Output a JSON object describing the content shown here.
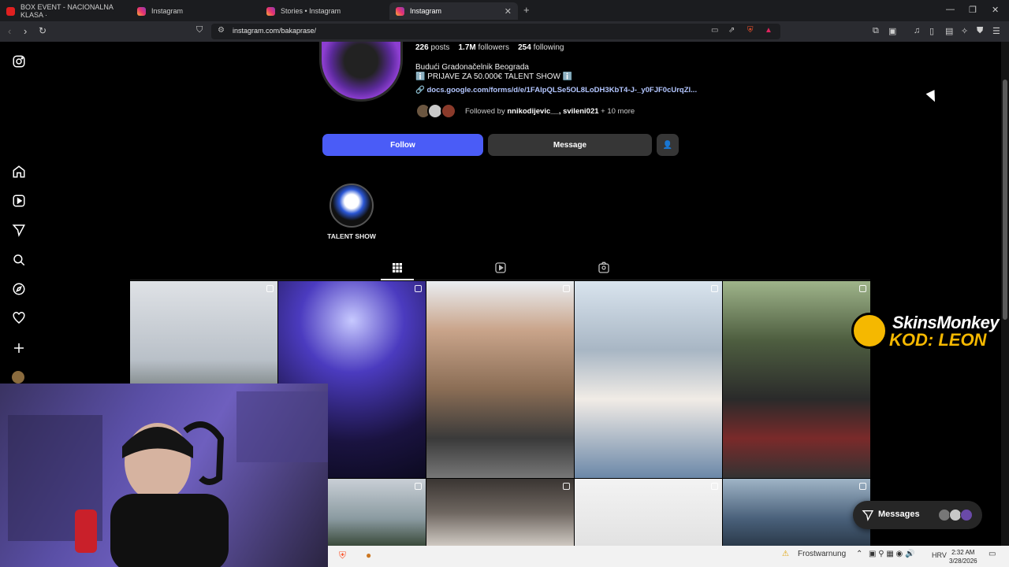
{
  "browser": {
    "tabs": [
      {
        "title": "BOX EVENT - NACIONALNA KLASA ·",
        "favicon": "youtube-icon",
        "active": false
      },
      {
        "title": "Instagram",
        "favicon": "instagram-icon",
        "active": false
      },
      {
        "title": "Stories • Instagram",
        "favicon": "instagram-icon",
        "active": false
      },
      {
        "title": "Instagram",
        "favicon": "instagram-icon",
        "active": true
      }
    ],
    "url": "instagram.com/bakaprase/"
  },
  "profile": {
    "stats": {
      "posts_value": "226",
      "posts_label": "posts",
      "followers_value": "1.7M",
      "followers_label": "followers",
      "following_value": "254",
      "following_label": "following"
    },
    "bio_line1": "Budući Gradonačelnik Beograda",
    "bio_line2": "ℹ️ PRIJAVE ZA 50.000€ TALENT SHOW ℹ️",
    "link": "docs.google.com/forms/d/e/1FAIpQLSe5OL8LoDH3KbT4-J-_y0FJF0cUrqZl...",
    "followed_by_prefix": "Followed by",
    "followed_by_names": "nnikodijevic__, svileni021",
    "followed_by_suffix": "+ 10 more",
    "follow_label": "Follow",
    "message_label": "Message"
  },
  "highlight": {
    "label": "TALENT SHOW"
  },
  "sponsor": {
    "line1": "SkinsMonkey",
    "line2": "KOD: LEON"
  },
  "messages": {
    "label": "Messages"
  },
  "taskbar": {
    "weather": "Frostwarnung",
    "lang": "HRV",
    "time": "2:32 AM",
    "date": "3/28/2026"
  },
  "colors": {
    "follow_button": "#4a5cf7",
    "link": "#b3c6ff",
    "sponsor_yellow": "#f5b800"
  }
}
